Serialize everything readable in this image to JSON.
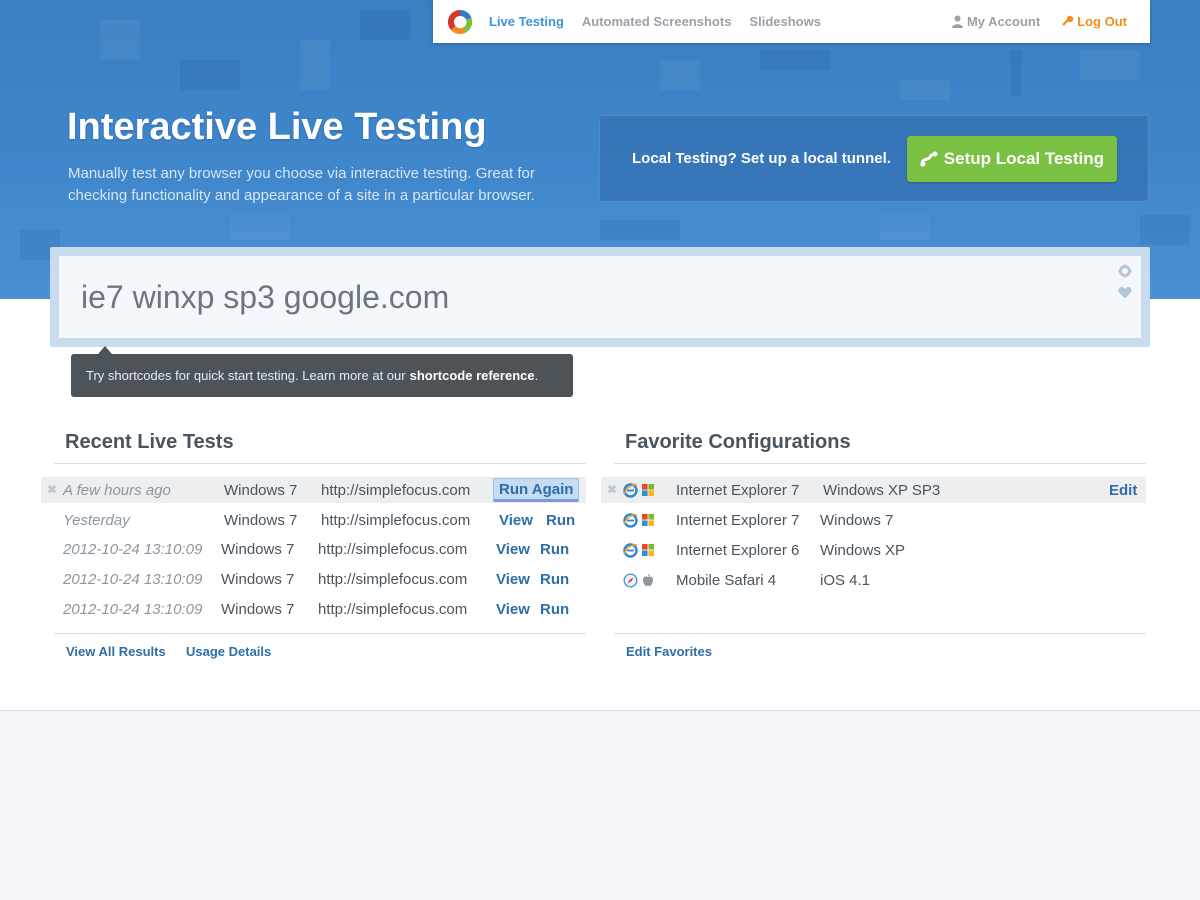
{
  "nav": {
    "items": [
      {
        "label": "Live Testing",
        "active": true
      },
      {
        "label": "Automated Screenshots",
        "active": false
      },
      {
        "label": "Slideshows",
        "active": false
      }
    ],
    "my_account": "My Account",
    "log_out": "Log Out"
  },
  "hero": {
    "title": "Interactive Live Testing",
    "description": "Manually test any browser you choose via interactive testing. Great for checking functionality and appearance of a site in a particular browser."
  },
  "local": {
    "text": "Local Testing?  Set up a local tunnel.",
    "button_label": "Setup Local Testing"
  },
  "search": {
    "value": "ie7 winxp sp3 google.com",
    "placeholder": ""
  },
  "tooltip": {
    "text": "Try shortcodes for quick start testing.  Learn more at our",
    "link": "shortcode reference",
    "suffix": "."
  },
  "recent": {
    "title": "Recent Live Tests",
    "rows": [
      {
        "time": "A few hours ago",
        "os": "Windows 7",
        "url": "http://simplefocus.com",
        "action1": "Run Again",
        "action2": ""
      },
      {
        "time": "Yesterday",
        "os": "Windows 7",
        "url": "http://simplefocus.com",
        "action1": "View",
        "action2": "Run"
      },
      {
        "time": "2012-10-24 13:10:09",
        "os": "Windows 7",
        "url": "http://simplefocus.com",
        "action1": "View",
        "action2": "Run"
      },
      {
        "time": "2012-10-24 13:10:09",
        "os": "Windows 7",
        "url": "http://simplefocus.com",
        "action1": "View",
        "action2": "Run"
      },
      {
        "time": "2012-10-24 13:10:09",
        "os": "Windows 7",
        "url": "http://simplefocus.com",
        "action1": "View",
        "action2": "Run"
      }
    ],
    "view_all": "View All Results",
    "usage": "Usage Details"
  },
  "favorites": {
    "title": "Favorite Configurations",
    "rows": [
      {
        "browser": "Internet Explorer 7",
        "os": "Windows XP SP3",
        "edit": "Edit",
        "browser_icon": "ie-icon",
        "os_icon": "windows-icon"
      },
      {
        "browser": "Internet Explorer 7",
        "os": "Windows 7",
        "edit": "",
        "browser_icon": "ie-icon",
        "os_icon": "windows-icon"
      },
      {
        "browser": "Internet Explorer 6",
        "os": "Windows XP",
        "edit": "",
        "browser_icon": "ie-icon",
        "os_icon": "windows-icon"
      },
      {
        "browser": "Mobile Safari 4",
        "os": "iOS 4.1",
        "edit": "",
        "browser_icon": "safari-icon",
        "os_icon": "apple-icon"
      }
    ],
    "edit_favorites": "Edit Favorites"
  },
  "colors": {
    "accent": "#3d93d8",
    "logout": "#f28c1e",
    "green": "#7ac043",
    "link": "#2e6ea6"
  }
}
